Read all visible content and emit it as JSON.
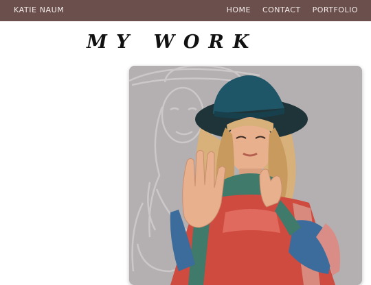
{
  "navbar": {
    "brand": "KATIE NAUM",
    "links": [
      "HOME",
      "CONTACT",
      "PORTFOLIO"
    ],
    "background": "#6b4f4c",
    "text_color": "#f4ecea"
  },
  "page": {
    "title": "MY WORK"
  },
  "portfolio": {
    "image_subject": "portrait-illustration",
    "background": "#b4b0b1"
  }
}
